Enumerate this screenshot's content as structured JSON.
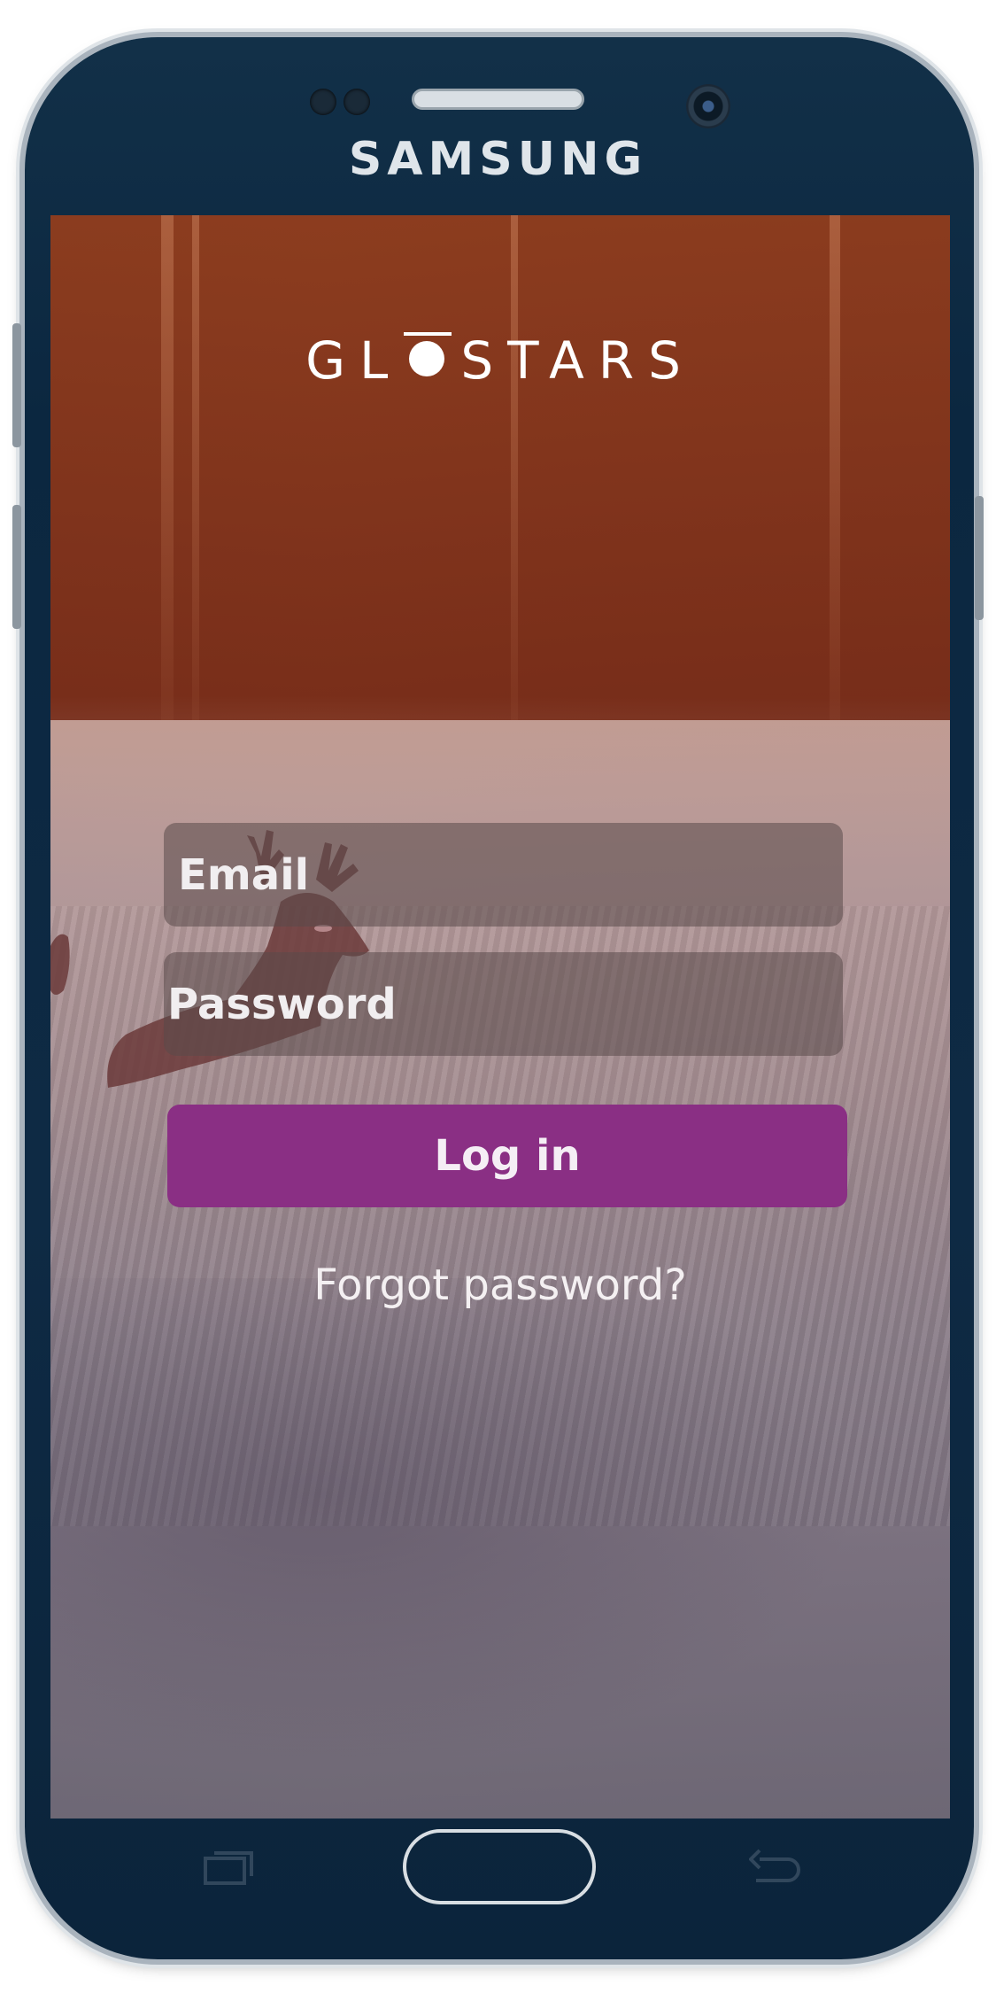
{
  "device": {
    "brand": "SAMSUNG"
  },
  "app": {
    "logo_text_left": "GL",
    "logo_text_right": "STARS"
  },
  "login_form": {
    "email_placeholder": "Email",
    "password_placeholder": "Password",
    "login_label": "Log in",
    "forgot_label": "Forgot password?"
  },
  "colors": {
    "login_button": "#8a2f84",
    "input_background": "rgba(90,75,75,0.55)"
  },
  "icons": {
    "recent_apps": "recent-apps-icon",
    "home": "home-button-icon",
    "back": "back-icon"
  }
}
